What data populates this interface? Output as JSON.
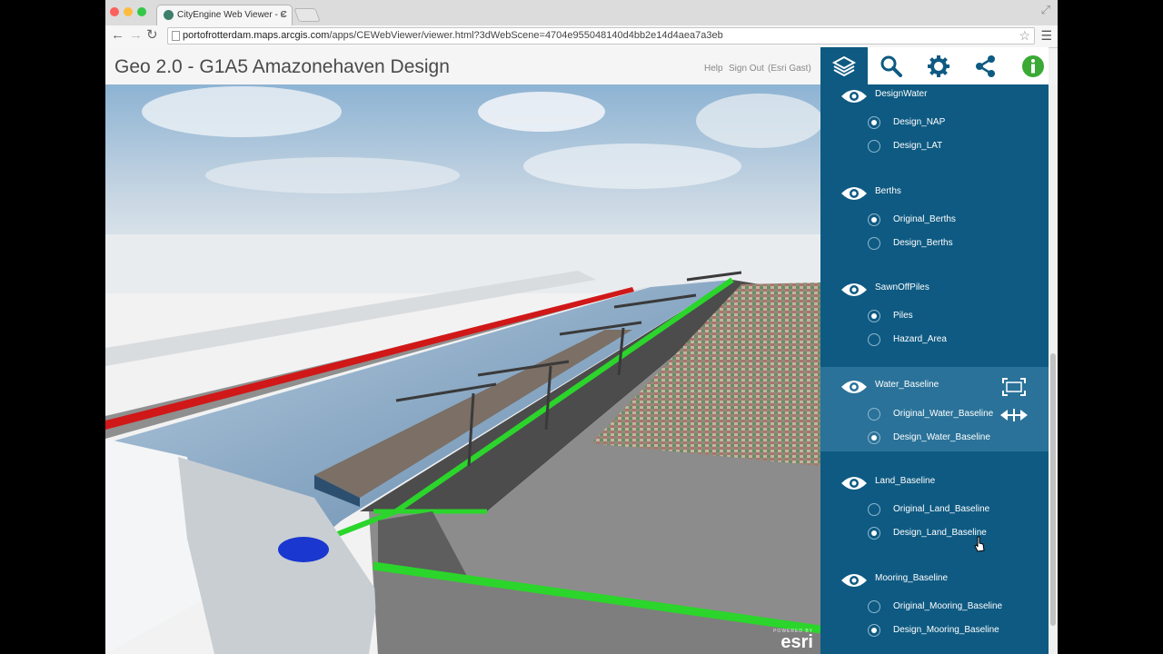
{
  "browser": {
    "tab_title": "CityEngine Web Viewer - C",
    "url_host": "portofrotterdam.maps.arcgis.com",
    "url_path": "/apps/CEWebViewer/viewer.html?3dWebScene=4704e955048140d4bb2e14d4aea7a3eb"
  },
  "app": {
    "title": "Geo 2.0 - G1A5 Amazonehaven Design",
    "links": {
      "help": "Help",
      "sign_out": "Sign Out",
      "user": "(Esri Gast)"
    }
  },
  "toolbar": {
    "tools": [
      "layers-icon",
      "search-icon",
      "gear-icon",
      "share-icon",
      "info-icon"
    ],
    "accent": "#0e5a82",
    "info_color": "#3aa935"
  },
  "layers": [
    {
      "name": "DesignWater",
      "options": [
        {
          "label": "Design_NAP",
          "selected": true
        },
        {
          "label": "Design_LAT",
          "selected": false
        }
      ]
    },
    {
      "name": "Berths",
      "options": [
        {
          "label": "Original_Berths",
          "selected": true
        },
        {
          "label": "Design_Berths",
          "selected": false
        }
      ]
    },
    {
      "name": "SawnOffPiles",
      "options": [
        {
          "label": "Piles",
          "selected": true
        },
        {
          "label": "Hazard_Area",
          "selected": false
        }
      ]
    },
    {
      "name": "Water_Baseline",
      "options": [
        {
          "label": "Original_Water_Baseline",
          "selected": false
        },
        {
          "label": "Design_Water_Baseline",
          "selected": true
        }
      ]
    },
    {
      "name": "Land_Baseline",
      "options": [
        {
          "label": "Original_Land_Baseline",
          "selected": false
        },
        {
          "label": "Design_Land_Baseline",
          "selected": true
        }
      ]
    },
    {
      "name": "Mooring_Baseline",
      "options": [
        {
          "label": "Original_Mooring_Baseline",
          "selected": false
        },
        {
          "label": "Design_Mooring_Baseline",
          "selected": true
        }
      ]
    }
  ],
  "branding": {
    "powered_by": "POWERED BY",
    "logo": "esri"
  }
}
